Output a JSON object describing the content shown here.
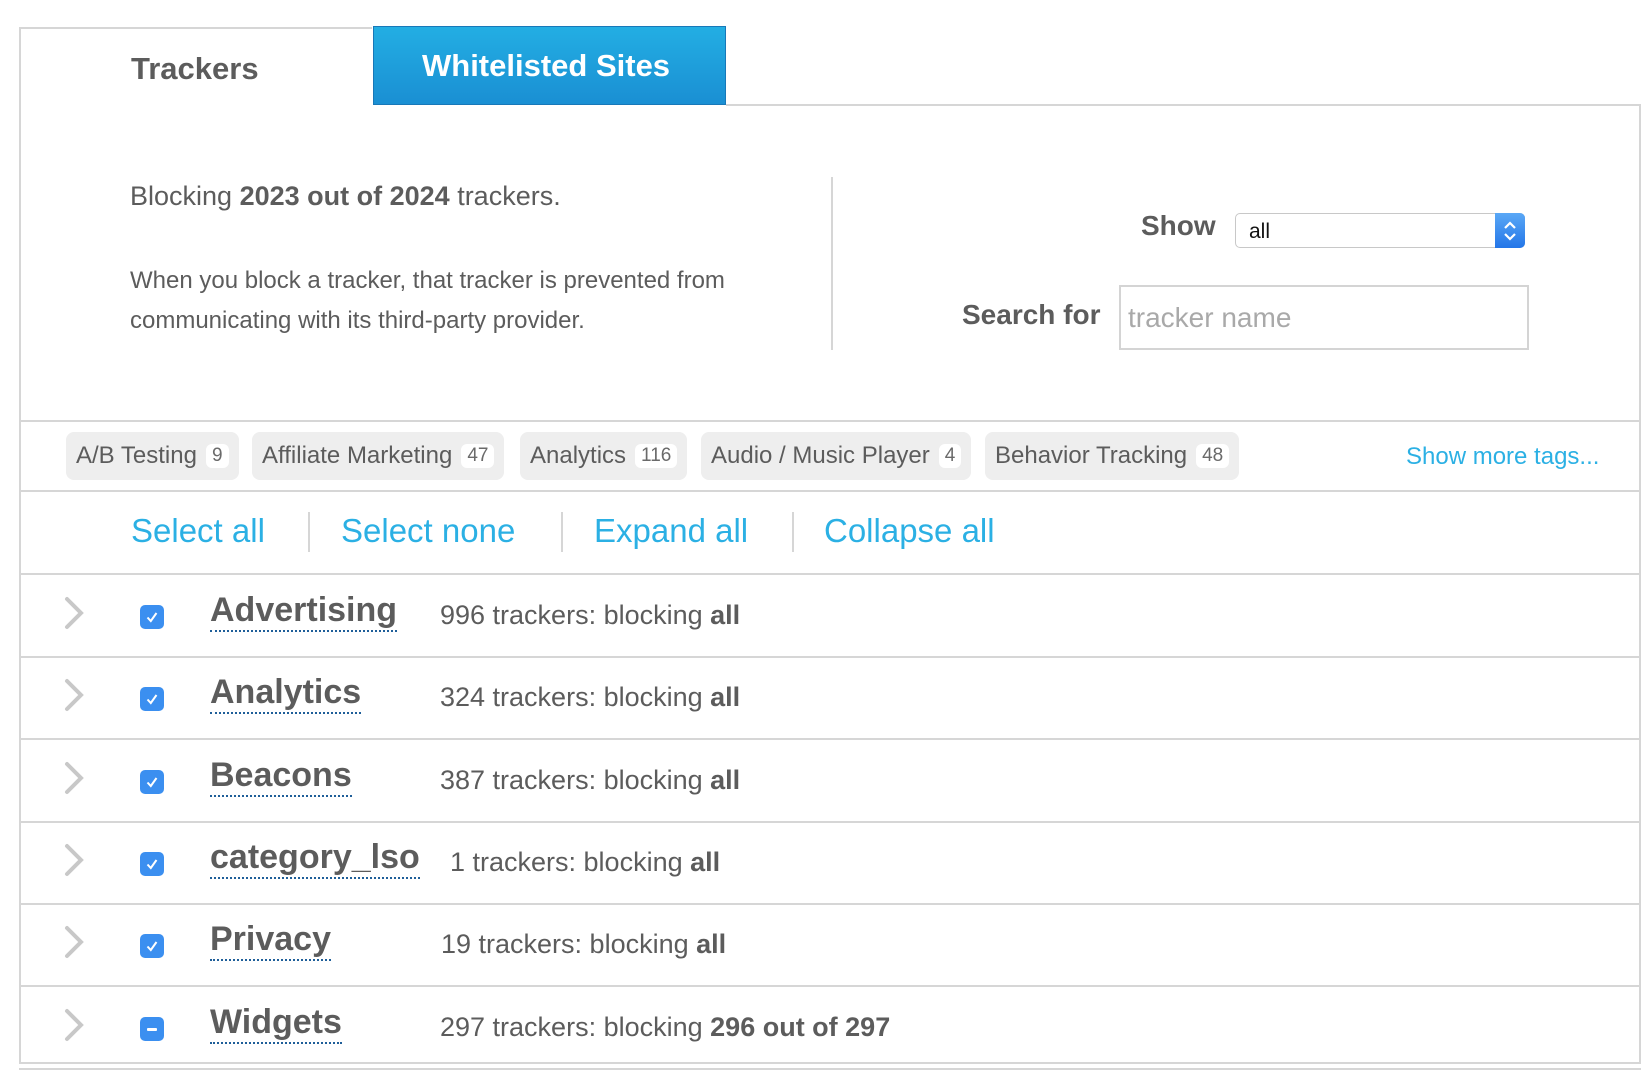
{
  "tabs": [
    {
      "label": "Trackers",
      "active": false
    },
    {
      "label": "Whitelisted Sites",
      "active": true
    }
  ],
  "summary": {
    "prefix": "Blocking",
    "bold": "2023 out of 2024",
    "suffix": "trackers.",
    "description": "When you block a tracker, that tracker is prevented from communicating with its third-party provider."
  },
  "filters": {
    "show_label": "Show",
    "show_value": "all",
    "search_label": "Search for",
    "search_placeholder": "tracker name",
    "search_value": ""
  },
  "tags": [
    {
      "label": "A/B Testing",
      "count": "9"
    },
    {
      "label": "Affiliate Marketing",
      "count": "47"
    },
    {
      "label": "Analytics",
      "count": "116"
    },
    {
      "label": "Audio / Music Player",
      "count": "4"
    },
    {
      "label": "Behavior Tracking",
      "count": "48"
    }
  ],
  "show_more_tags": "Show more tags...",
  "actions": {
    "select_all": "Select all",
    "select_none": "Select none",
    "expand_all": "Expand all",
    "collapse_all": "Collapse all"
  },
  "categories": [
    {
      "name": "Advertising",
      "stat_prefix": "996 trackers: blocking",
      "stat_bold": "all",
      "state": "checked"
    },
    {
      "name": "Analytics",
      "stat_prefix": "324 trackers: blocking",
      "stat_bold": "all",
      "state": "checked"
    },
    {
      "name": "Beacons",
      "stat_prefix": "387 trackers: blocking",
      "stat_bold": "all",
      "state": "checked"
    },
    {
      "name": "category_lso",
      "stat_prefix": "1 trackers: blocking",
      "stat_bold": "all",
      "state": "checked"
    },
    {
      "name": "Privacy",
      "stat_prefix": "19 trackers: blocking",
      "stat_bold": "all",
      "state": "checked"
    },
    {
      "name": "Widgets",
      "stat_prefix": "297 trackers: blocking",
      "stat_bold": "296 out of 297",
      "state": "indeterminate"
    }
  ],
  "colors": {
    "accent": "#2bb0e4",
    "tab_active": "#1f9ddb",
    "checkbox": "#3b8ff0",
    "text": "#5c5c5c",
    "border": "#d6d6d6"
  }
}
